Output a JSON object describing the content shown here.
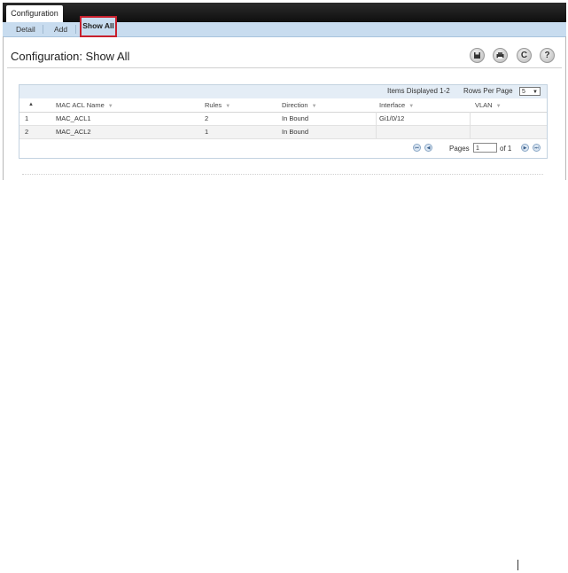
{
  "top_tab": {
    "label": "Configuration"
  },
  "subnav": {
    "items": [
      "Detail",
      "Add",
      "Show All"
    ],
    "active": "Show All",
    "active_outline_color": "#c8202d"
  },
  "page_title": "Configuration: Show All",
  "toolbar": {
    "icons": [
      "save-icon",
      "print-icon",
      "refresh-icon",
      "help-icon"
    ],
    "help_glyph": "?",
    "refresh_glyph": "C"
  },
  "table": {
    "items_displayed": "Items Displayed 1-2",
    "rows_per_page_label": "Rows Per Page",
    "rows_per_page_value": "5",
    "sort_glyph": "▲",
    "columns": [
      "MAC ACL Name",
      "Rules",
      "Direction",
      "Interface",
      "VLAN"
    ],
    "rows": [
      {
        "index": "1",
        "name": "MAC_ACL1",
        "rules": "2",
        "direction": "In Bound",
        "interface": "Gi1/0/12",
        "vlan": ""
      },
      {
        "index": "2",
        "name": "MAC_ACL2",
        "rules": "1",
        "direction": "In Bound",
        "interface": "",
        "vlan": ""
      }
    ],
    "pager": {
      "pages_label": "Pages",
      "page_value": "1",
      "of_label": "of 1"
    }
  },
  "colors": {
    "nav_bar": "#1a1a1a",
    "subnav_bg": "#c8dcef",
    "panel_header": "#e4edf6"
  }
}
